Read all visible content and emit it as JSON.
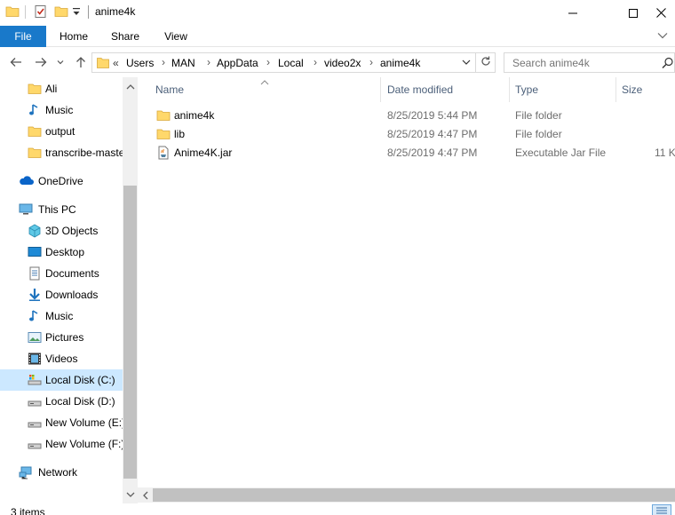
{
  "window": {
    "title": "anime4k"
  },
  "ribbon": {
    "tabs": [
      "File",
      "Home",
      "Share",
      "View"
    ]
  },
  "address": {
    "overflow": "«",
    "crumbs": [
      "Users",
      "MAN",
      "AppData",
      "Local",
      "video2x",
      "anime4k"
    ]
  },
  "search": {
    "placeholder": "Search anime4k"
  },
  "nav": {
    "items": [
      {
        "label": "Ali",
        "icon": "folder-icon"
      },
      {
        "label": "Music",
        "icon": "music-icon"
      },
      {
        "label": "output",
        "icon": "folder-icon"
      },
      {
        "label": "transcribe-master",
        "icon": "folder-icon"
      },
      {
        "label": "OneDrive",
        "icon": "cloud-icon"
      },
      {
        "label": "This PC",
        "icon": "computer-icon"
      },
      {
        "label": "3D Objects",
        "icon": "cube-icon"
      },
      {
        "label": "Desktop",
        "icon": "desktop-icon"
      },
      {
        "label": "Documents",
        "icon": "documents-icon"
      },
      {
        "label": "Downloads",
        "icon": "download-icon"
      },
      {
        "label": "Music",
        "icon": "music-icon"
      },
      {
        "label": "Pictures",
        "icon": "pictures-icon"
      },
      {
        "label": "Videos",
        "icon": "videos-icon"
      },
      {
        "label": "Local Disk (C:)",
        "icon": "drive-icon",
        "selected": true
      },
      {
        "label": "Local Disk (D:)",
        "icon": "drive-icon"
      },
      {
        "label": "New Volume (E:)",
        "icon": "drive-icon"
      },
      {
        "label": "New Volume (F:)",
        "icon": "drive-icon"
      },
      {
        "label": "Network",
        "icon": "network-icon"
      }
    ]
  },
  "columns": {
    "name": "Name",
    "date": "Date modified",
    "type": "Type",
    "size": "Size"
  },
  "files": [
    {
      "name": "anime4k",
      "date": "8/25/2019 5:44 PM",
      "type": "File folder",
      "size": "",
      "icon": "folder-icon"
    },
    {
      "name": "lib",
      "date": "8/25/2019 4:47 PM",
      "type": "File folder",
      "size": "",
      "icon": "folder-icon"
    },
    {
      "name": "Anime4K.jar",
      "date": "8/25/2019 4:47 PM",
      "type": "Executable Jar File",
      "size": "11 K",
      "icon": "jar-file-icon"
    }
  ],
  "status": {
    "count": "3 items"
  },
  "colors": {
    "accent": "#1979ca",
    "selection": "#cce8ff",
    "folder": "#ffd86b",
    "header_text": "#4c607a"
  }
}
